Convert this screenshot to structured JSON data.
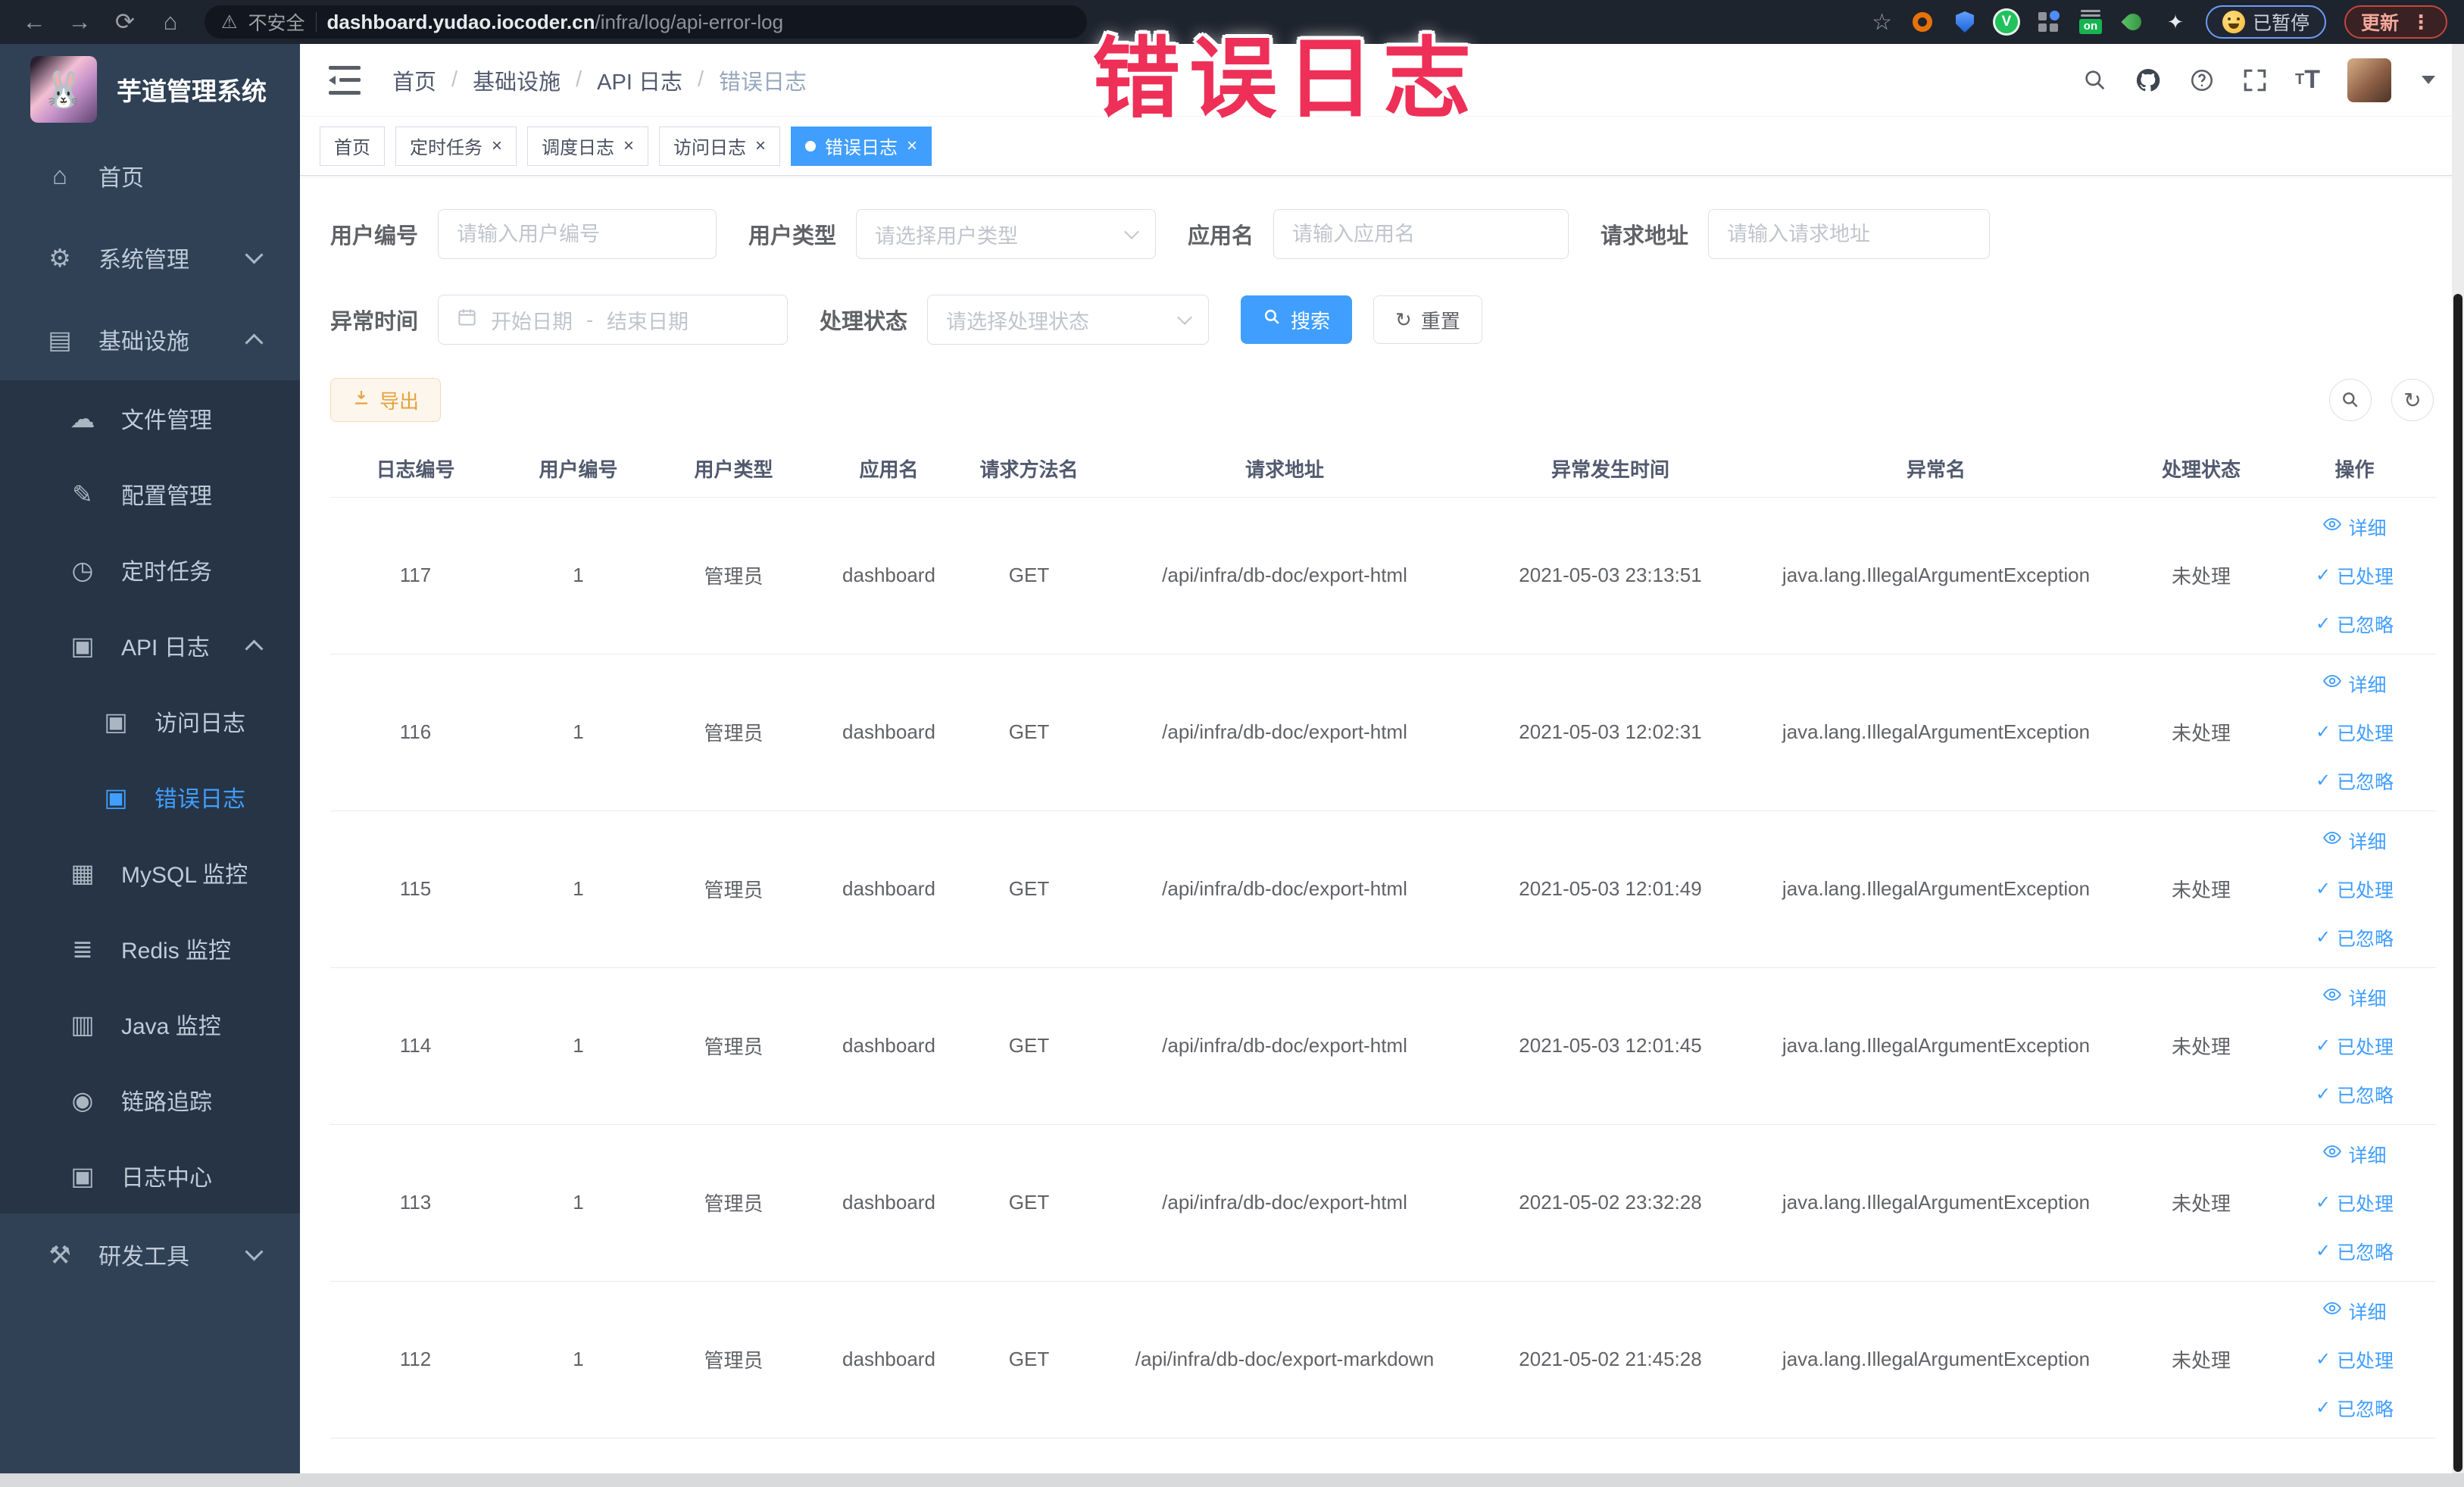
{
  "browser": {
    "security_label": "不安全",
    "url_domain": "dashboard.yudao.iocoder.cn",
    "url_path": "/infra/log/api-error-log",
    "extension_on_label": "on",
    "paused_label": "已暂停",
    "update_label": "更新"
  },
  "watermark": "错误日志",
  "sidebar": {
    "title": "芋道管理系统",
    "menu": [
      {
        "key": "home",
        "label": "首页",
        "icon": "home-icon",
        "level": 1
      },
      {
        "key": "system-management",
        "label": "系统管理",
        "icon": "gear-icon",
        "level": 1,
        "arrow": "down"
      },
      {
        "key": "infrastructure",
        "label": "基础设施",
        "icon": "infra-icon",
        "level": 1,
        "arrow": "up"
      },
      {
        "group": true,
        "items": [
          {
            "key": "file-management",
            "label": "文件管理",
            "icon": "cloud-icon",
            "level": 2
          },
          {
            "key": "config-management",
            "label": "配置管理",
            "icon": "edit-icon",
            "level": 2
          },
          {
            "key": "scheduled-tasks",
            "label": "定时任务",
            "icon": "timer-icon",
            "level": 2
          },
          {
            "key": "api-log",
            "label": "API 日志",
            "icon": "api-log-icon",
            "level": 2,
            "arrow": "up"
          },
          {
            "key": "access-log",
            "label": "访问日志",
            "icon": "doc-icon",
            "level": 3
          },
          {
            "key": "error-log",
            "label": "错误日志",
            "icon": "doc-icon",
            "level": 3,
            "active": true
          },
          {
            "key": "mysql-monitor",
            "label": "MySQL 监控",
            "icon": "mysql-icon",
            "level": 2
          },
          {
            "key": "redis-monitor",
            "label": "Redis 监控",
            "icon": "redis-icon",
            "level": 2
          },
          {
            "key": "java-monitor",
            "label": "Java 监控",
            "icon": "java-icon",
            "level": 2
          },
          {
            "key": "trace",
            "label": "链路追踪",
            "icon": "trace-icon",
            "level": 2
          },
          {
            "key": "log-center",
            "label": "日志中心",
            "icon": "log-center-icon",
            "level": 2
          }
        ]
      },
      {
        "key": "dev-tools",
        "label": "研发工具",
        "icon": "tools-icon",
        "level": 1,
        "arrow": "down"
      }
    ]
  },
  "navbar": {
    "breadcrumb": [
      "首页",
      "基础设施",
      "API 日志",
      "错误日志"
    ]
  },
  "tabs": [
    {
      "label": "首页",
      "closable": false,
      "active": false
    },
    {
      "label": "定时任务",
      "closable": true,
      "active": false
    },
    {
      "label": "调度日志",
      "closable": true,
      "active": false
    },
    {
      "label": "访问日志",
      "closable": true,
      "active": false
    },
    {
      "label": "错误日志",
      "closable": true,
      "active": true
    }
  ],
  "filters": {
    "user_id": {
      "label": "用户编号",
      "placeholder": "请输入用户编号"
    },
    "user_type": {
      "label": "用户类型",
      "placeholder": "请选择用户类型"
    },
    "app_name": {
      "label": "应用名",
      "placeholder": "请输入应用名"
    },
    "request_url": {
      "label": "请求地址",
      "placeholder": "请输入请求地址"
    },
    "exception_time": {
      "label": "异常时间",
      "start_placeholder": "开始日期",
      "separator": "-",
      "end_placeholder": "结束日期"
    },
    "process_status": {
      "label": "处理状态",
      "placeholder": "请选择处理状态"
    },
    "search_label": "搜索",
    "reset_label": "重置"
  },
  "toolbar": {
    "export_label": "导出"
  },
  "table": {
    "columns": [
      "日志编号",
      "用户编号",
      "用户类型",
      "应用名",
      "请求方法名",
      "请求地址",
      "异常发生时间",
      "异常名",
      "处理状态",
      "操作"
    ],
    "actions": [
      "详细",
      "已处理",
      "已忽略"
    ],
    "rows": [
      {
        "id": "117",
        "user_id": "1",
        "user_type": "管理员",
        "app": "dashboard",
        "method": "GET",
        "url": "/api/infra/db-doc/export-html",
        "time": "2021-05-03 23:13:51",
        "exception": "java.lang.IllegalArgumentException",
        "status": "未处理"
      },
      {
        "id": "116",
        "user_id": "1",
        "user_type": "管理员",
        "app": "dashboard",
        "method": "GET",
        "url": "/api/infra/db-doc/export-html",
        "time": "2021-05-03 12:02:31",
        "exception": "java.lang.IllegalArgumentException",
        "status": "未处理"
      },
      {
        "id": "115",
        "user_id": "1",
        "user_type": "管理员",
        "app": "dashboard",
        "method": "GET",
        "url": "/api/infra/db-doc/export-html",
        "time": "2021-05-03 12:01:49",
        "exception": "java.lang.IllegalArgumentException",
        "status": "未处理"
      },
      {
        "id": "114",
        "user_id": "1",
        "user_type": "管理员",
        "app": "dashboard",
        "method": "GET",
        "url": "/api/infra/db-doc/export-html",
        "time": "2021-05-03 12:01:45",
        "exception": "java.lang.IllegalArgumentException",
        "status": "未处理"
      },
      {
        "id": "113",
        "user_id": "1",
        "user_type": "管理员",
        "app": "dashboard",
        "method": "GET",
        "url": "/api/infra/db-doc/export-html",
        "time": "2021-05-02 23:32:28",
        "exception": "java.lang.IllegalArgumentException",
        "status": "未处理"
      },
      {
        "id": "112",
        "user_id": "1",
        "user_type": "管理员",
        "app": "dashboard",
        "method": "GET",
        "url": "/api/infra/db-doc/export-markdown",
        "time": "2021-05-02 21:45:28",
        "exception": "java.lang.IllegalArgumentException",
        "status": "未处理"
      }
    ]
  },
  "colors": {
    "primary": "#409EFF",
    "warning": "#e6a23c",
    "watermark_red": "#ee2f57",
    "sidebar_bg": "#304156",
    "submenu_bg": "#263445"
  }
}
